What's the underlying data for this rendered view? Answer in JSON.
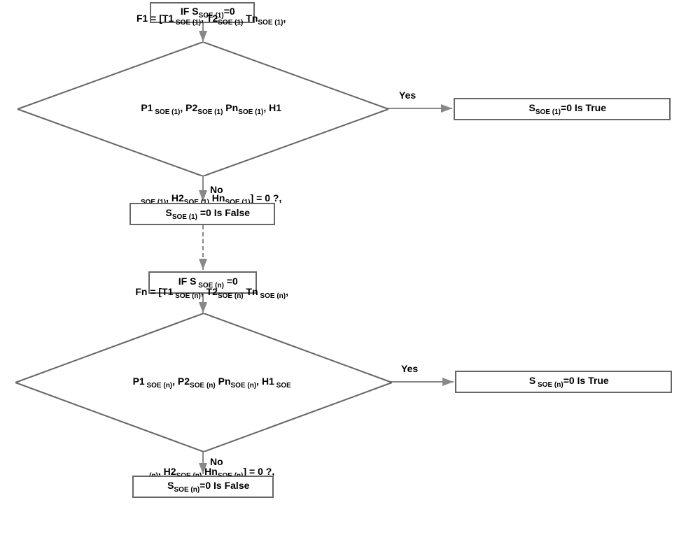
{
  "chart_data": {
    "type": "flowchart",
    "nodes": [
      {
        "id": "n1",
        "shape": "rect",
        "text": "IF S_SOE(1)=0"
      },
      {
        "id": "n2",
        "shape": "diamond",
        "text": "F1 = [T1_SOE(1), T2_SOE(1) Tn_SOE(1),\nP1_SOE(1), P2_SOE(1) Pn_SOE(1), H1\nSOE(1), H2_SOE(1) Hn_SOE(1)] = 0 ?,"
      },
      {
        "id": "n3",
        "shape": "rect",
        "text": "S_SOE(1)=0 Is True"
      },
      {
        "id": "n4",
        "shape": "rect",
        "text": "S_SOE(1) =0 Is False"
      },
      {
        "id": "n5",
        "shape": "rect",
        "text": "IF S_SOE(n) =0"
      },
      {
        "id": "n6",
        "shape": "diamond",
        "text": "Fn = [T1_SOE(n), T2_SOE(n) Tn_SOE(n),\nP1_SOE(n), P2_SOE(n) Pn_SOE(n), H1_SOE\n(n), H2_SOE(n) Hn_SOE(n)] = 0 ?,"
      },
      {
        "id": "n7",
        "shape": "rect",
        "text": "S_SOE(n)=0 Is True"
      },
      {
        "id": "n8",
        "shape": "rect",
        "text": "S_SOE(n)=0 Is False"
      }
    ],
    "edges": [
      {
        "from": "n1",
        "to": "n2",
        "label": ""
      },
      {
        "from": "n2",
        "to": "n3",
        "label": "Yes"
      },
      {
        "from": "n2",
        "to": "n4",
        "label": "No"
      },
      {
        "from": "n4",
        "to": "n5",
        "label": "",
        "style": "dashed"
      },
      {
        "from": "n5",
        "to": "n6",
        "label": ""
      },
      {
        "from": "n6",
        "to": "n7",
        "label": "Yes"
      },
      {
        "from": "n6",
        "to": "n8",
        "label": "No"
      }
    ]
  },
  "labels": {
    "yes": "Yes",
    "no": "No"
  },
  "text": {
    "n1_prefix": "IF S",
    "n1_sub": "SOE (1)",
    "n1_suffix": "=0",
    "n3_prefix": "S",
    "n3_sub": "SOE (1)",
    "n3_suffix": "=0 Is True",
    "n4_prefix": "S",
    "n4_sub": "SOE (1)",
    "n4_suffix": " =0 Is False",
    "n5_prefix": "IF S",
    "n5_sub": " SOE (n)",
    "n5_suffix": " =0",
    "n7_prefix": "S",
    "n7_sub": " SOE (n)",
    "n7_suffix": "=0 Is True",
    "n8_prefix": "S",
    "n8_sub": "SOE (n)",
    "n8_suffix": "=0 Is False",
    "d1_l1a": "F1 = [T1",
    "d1_l1s1": " SOE (1)",
    "d1_l1b": ", T2",
    "d1_l1s2": "SOE (1)",
    "d1_l1c": " Tn",
    "d1_l1s3": "SOE (1)",
    "d1_l1d": ",",
    "d1_l2a": "P1",
    "d1_l2s1": " SOE (1)",
    "d1_l2b": ", P2",
    "d1_l2s2": "SOE (1)",
    "d1_l2c": " Pn",
    "d1_l2s3": "SOE (1)",
    "d1_l2d": ", H1",
    "d1_l3s1": "SOE (1)",
    "d1_l3a": ", H2",
    "d1_l3s2": "SOE (1)",
    "d1_l3b": " Hn",
    "d1_l3s3": "SOE (1)",
    "d1_l3c": "] = 0 ?,",
    "d2_l1a": "Fn = [T1",
    "d2_l1s1": " SOE (n)",
    "d2_l1b": ", T2",
    "d2_l1s2": "SOE (n)",
    "d2_l1c": " Tn",
    "d2_l1s3": " SOE (n)",
    "d2_l1d": ",",
    "d2_l2a": "P1",
    "d2_l2s1": " SOE (n)",
    "d2_l2b": ", P2",
    "d2_l2s2": "SOE (n)",
    "d2_l2c": " Pn",
    "d2_l2s3": "SOE (n)",
    "d2_l2d": ", H1",
    "d2_l2s4": " SOE",
    "d2_l3s0": "(n)",
    "d2_l3a": ", H2",
    "d2_l3s1": "SOE (n)",
    "d2_l3b": " Hn",
    "d2_l3s2": "SOE (n)",
    "d2_l3c": "] = 0 ?,"
  }
}
